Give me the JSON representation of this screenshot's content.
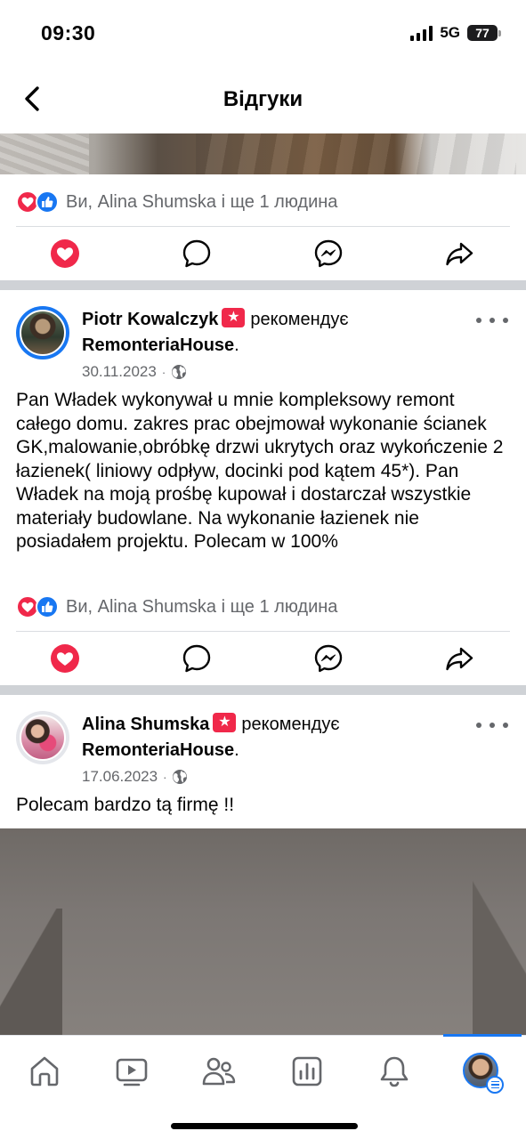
{
  "status_bar": {
    "time": "09:30",
    "network": "5G",
    "battery": "77"
  },
  "header": {
    "title": "Відгуки",
    "back_icon": "chevron-left-icon"
  },
  "first_post_tail": {
    "reactions_text": "Ви, Alina Shumska і ще 1 людина"
  },
  "posts": [
    {
      "author": "Piotr Kowalczyk",
      "action": "рекомендує",
      "page": "RemonteriaHouse",
      "punct": ".",
      "date": "30.11.2023",
      "text": "Pan Władek wykonywał u mnie kompleksowy remont całego domu. zakres prac obejmował wykonanie ścianek GK,malowanie,obróbkę drzwi ukrytych oraz wykończenie 2 łazienek( liniowy odpływ, docinki pod kątem 45*). Pan Władek na moją prośbę kupował i dostarczał wszystkie materiały budowlane. Na wykonanie łazienek nie posiadałem projektu. Polecam w 100%",
      "reactions_text": "Ви, Alina Shumska і ще 1 людина"
    },
    {
      "author": "Alina Shumska",
      "action": "рекомендує",
      "page": "RemonteriaHouse",
      "punct": ".",
      "date": "17.06.2023",
      "text": "Polecam bardzo tą firmę !!"
    }
  ],
  "bottom_nav": {
    "items": [
      "home-icon",
      "video-icon",
      "friends-icon",
      "dashboard-icon",
      "notifications-icon",
      "profile-menu-icon"
    ],
    "active": "profile-menu-icon"
  },
  "colors": {
    "love": "#f0284a",
    "like": "#1877f2",
    "secondary_text": "#65676b",
    "separator": "#cfd2d6"
  }
}
